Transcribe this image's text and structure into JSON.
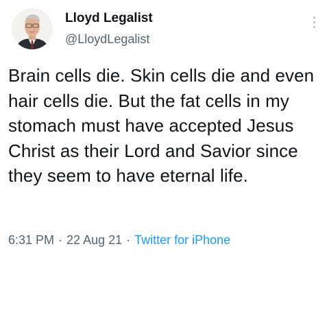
{
  "tweet": {
    "author_name": "Lloyd Legalist",
    "author_handle": "@LloydLegalist",
    "text": "Brain cells die. Skin cells die and even hair cells die. But the fat cells in my stomach must have accepted Jesus Christ as their Lord and Savior since they seem to have eternal life.",
    "time": "6:31 PM",
    "date": "22 Aug 21",
    "separator": "·",
    "source": "Twitter for iPhone"
  },
  "icons": {
    "more": "more-options-icon",
    "avatar": "profile-avatar"
  },
  "colors": {
    "text": "#0f1419",
    "secondary": "#536471",
    "link": "#1d9bf0",
    "background": "#ffffff"
  }
}
